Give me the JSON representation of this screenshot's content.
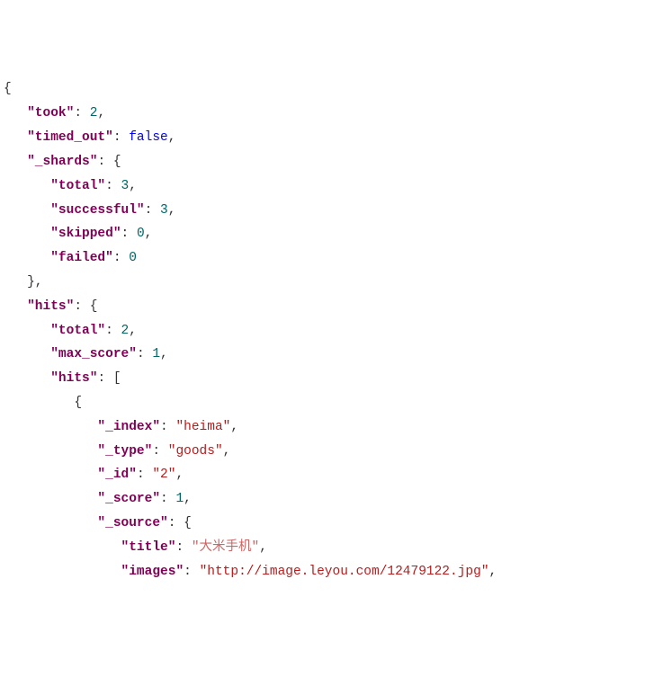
{
  "l1": {
    "br": "{"
  },
  "l2": {
    "key": "\"took\"",
    "col": ": ",
    "val": "2",
    "comma": ","
  },
  "l3": {
    "key": "\"timed_out\"",
    "col": ": ",
    "val": "false",
    "comma": ","
  },
  "l4": {
    "key": "\"_shards\"",
    "col": ": ",
    "val": "{"
  },
  "l5": {
    "key": "\"total\"",
    "col": ": ",
    "val": "3",
    "comma": ","
  },
  "l6": {
    "key": "\"successful\"",
    "col": ": ",
    "val": "3",
    "comma": ","
  },
  "l7": {
    "key": "\"skipped\"",
    "col": ": ",
    "val": "0",
    "comma": ","
  },
  "l8": {
    "key": "\"failed\"",
    "col": ": ",
    "val": "0"
  },
  "l9": {
    "br": "},"
  },
  "l10": {
    "key": "\"hits\"",
    "col": ": ",
    "val": "{"
  },
  "l11": {
    "key": "\"total\"",
    "col": ": ",
    "val": "2",
    "comma": ","
  },
  "l12": {
    "key": "\"max_score\"",
    "col": ": ",
    "val": "1",
    "comma": ","
  },
  "l13": {
    "key": "\"hits\"",
    "col": ": ",
    "val": "["
  },
  "l14": {
    "br": "{"
  },
  "l15": {
    "key": "\"_index\"",
    "col": ": ",
    "val": "\"heima\"",
    "comma": ","
  },
  "l16": {
    "key": "\"_type\"",
    "col": ": ",
    "val": "\"goods\"",
    "comma": ","
  },
  "l17": {
    "key": "\"_id\"",
    "col": ": ",
    "val": "\"2\"",
    "comma": ","
  },
  "l18": {
    "key": "\"_score\"",
    "col": ": ",
    "val": "1",
    "comma": ","
  },
  "l19": {
    "key": "\"_source\"",
    "col": ": ",
    "val": "{"
  },
  "l20": {
    "key": "\"title\"",
    "col": ": ",
    "val": "\"大米手机\"",
    "comma": ","
  },
  "l21": {
    "key": "\"images\"",
    "col": ": ",
    "val": "\"http://image.leyou.com/12479122.jpg\"",
    "comma": ","
  }
}
